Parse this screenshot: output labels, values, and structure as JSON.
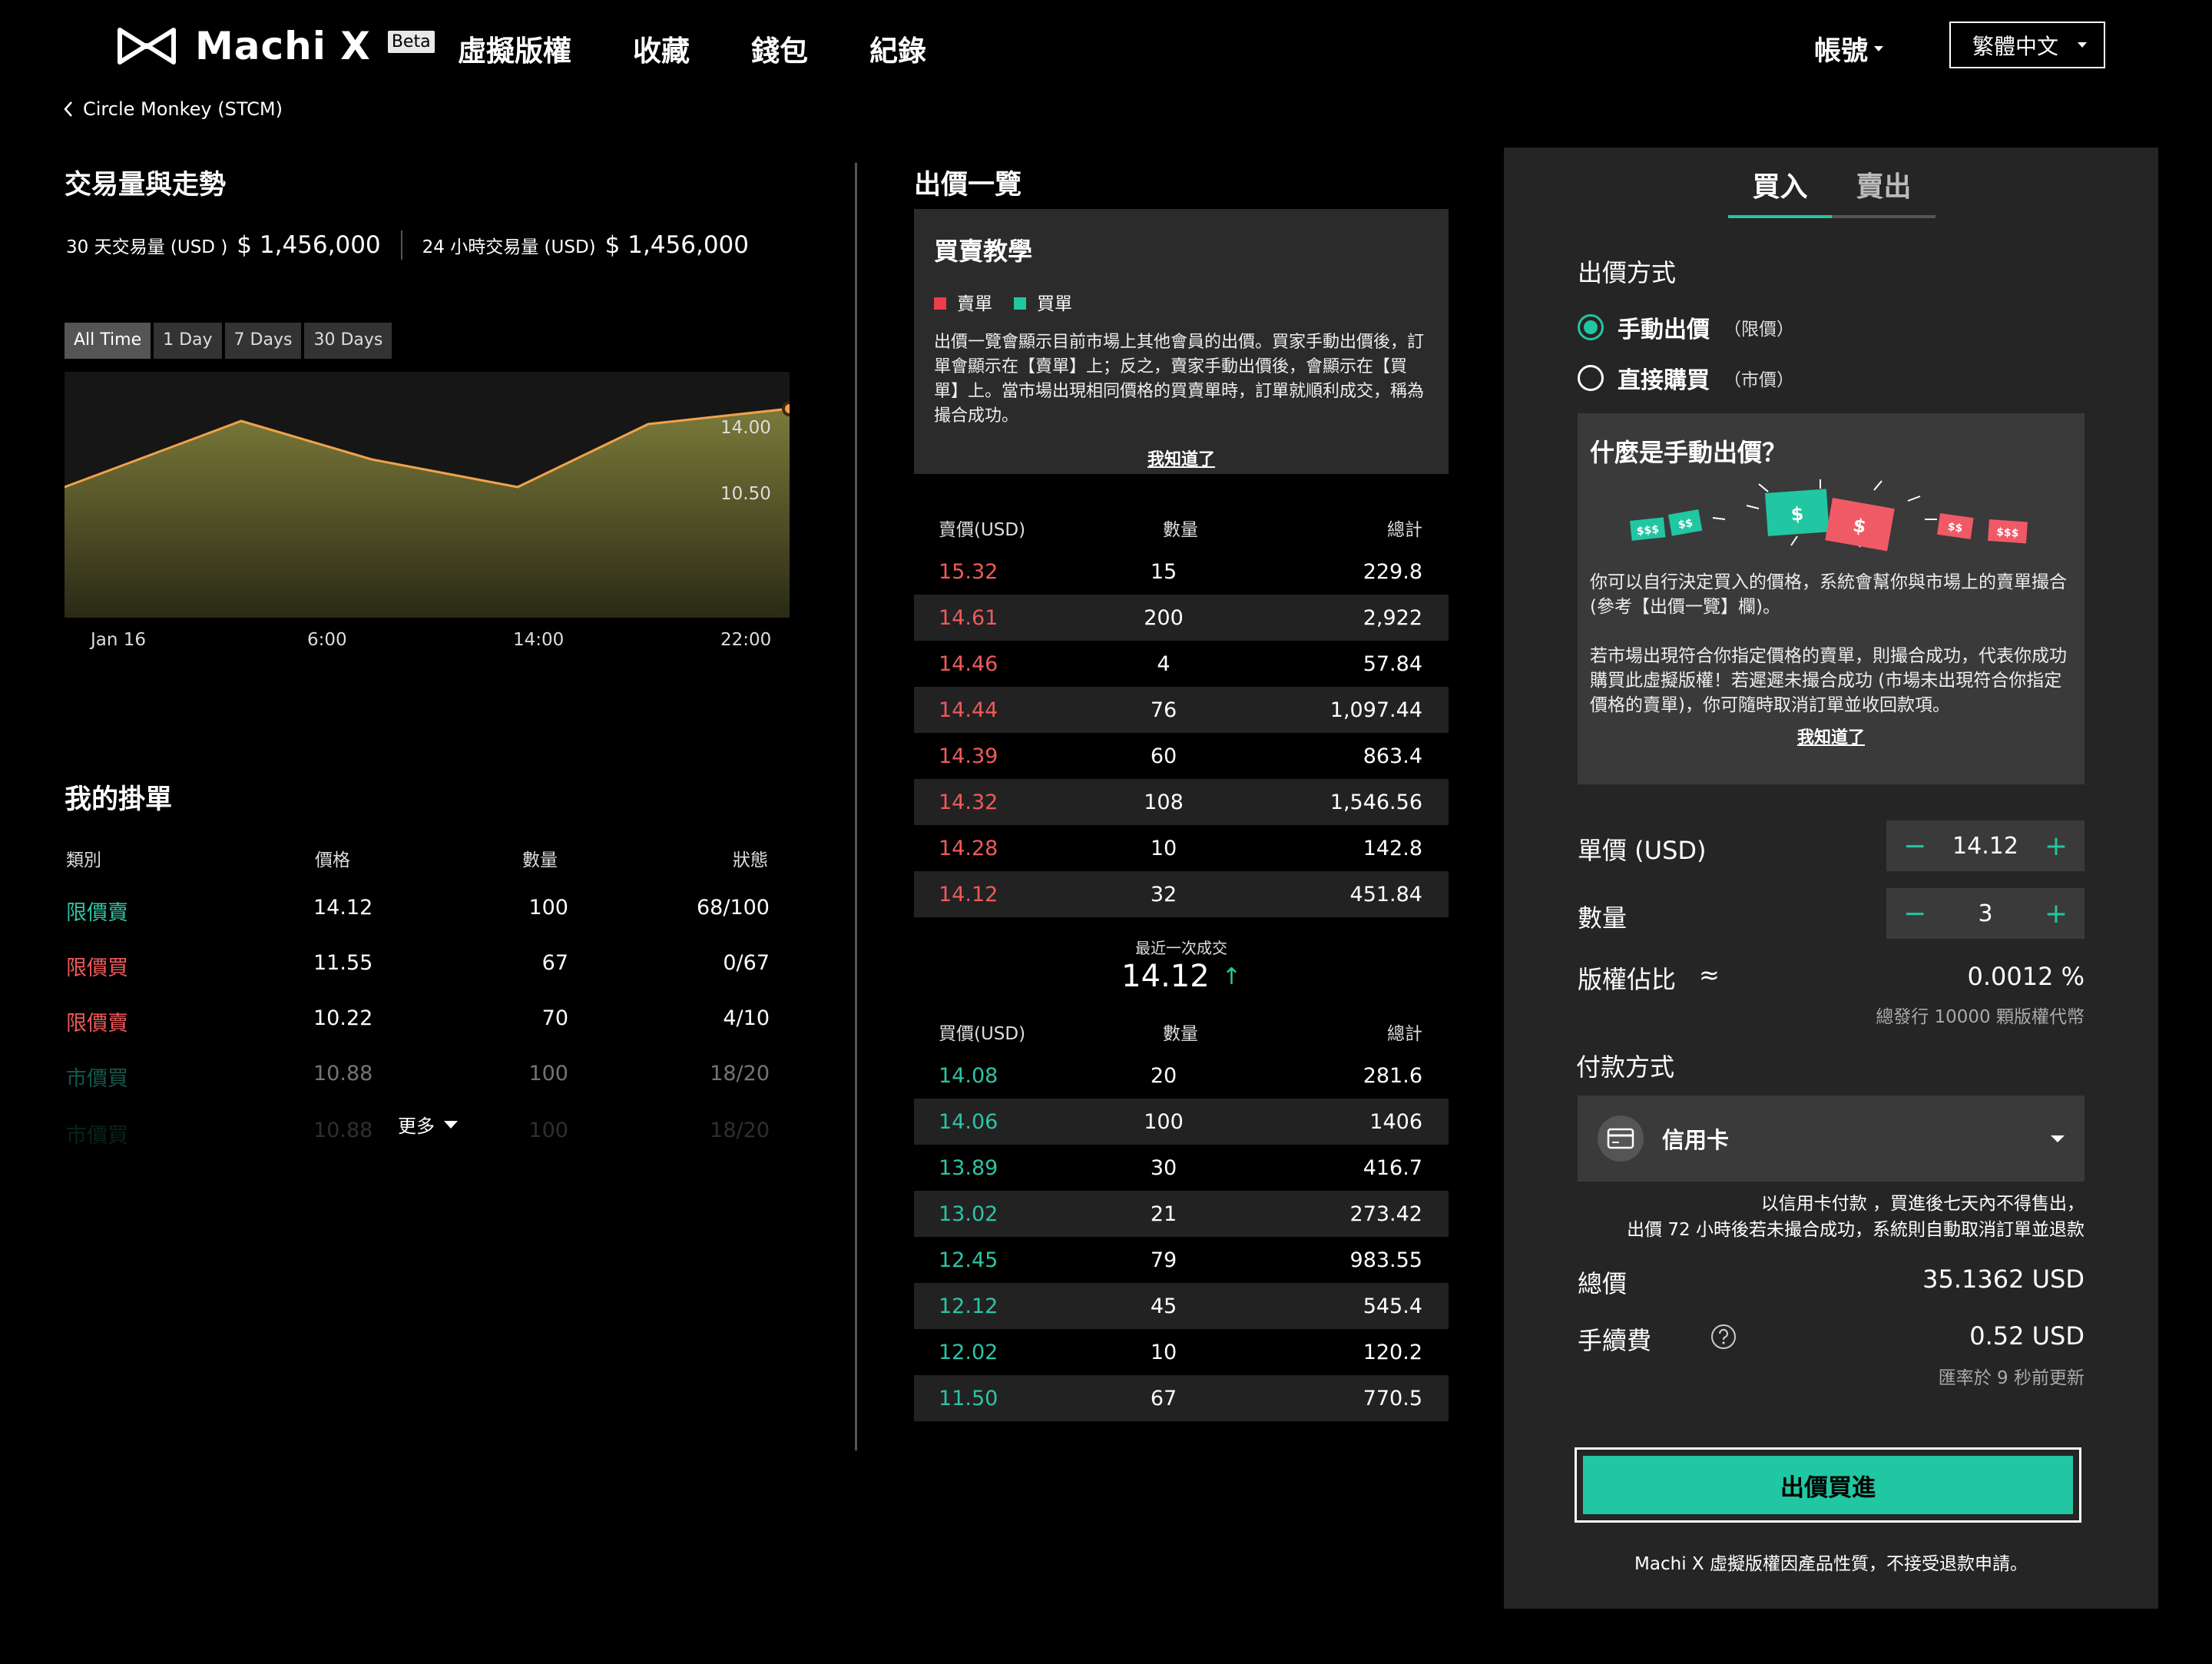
{
  "header": {
    "logo_text": "Machi X",
    "beta": "Beta",
    "nav": [
      "虛擬版權",
      "收藏",
      "錢包",
      "紀錄"
    ],
    "account": "帳號",
    "language": "繁體中文"
  },
  "breadcrumb": {
    "back_label": "Circle Monkey (STCM)"
  },
  "trend": {
    "title": "交易量與走勢",
    "vol30_label": "30 天交易量 (USD )",
    "vol30_value": "$ 1,456,000",
    "vol24_label": "24 小時交易量 (USD)",
    "vol24_value": "$ 1,456,000",
    "ranges": [
      "All Time",
      "1 Day",
      "7 Days",
      "30 Days"
    ],
    "active_range": "All Time"
  },
  "chart_data": {
    "type": "area",
    "x": [
      "Jan 16",
      "",
      "6:00",
      "",
      "14:00",
      "",
      "22:00",
      ""
    ],
    "x_tick_labels": [
      "Jan 16",
      "6:00",
      "14:00",
      "22:00"
    ],
    "y_tick_labels": [
      "14.00",
      "10.50"
    ],
    "series": [
      {
        "values": [
          9.5,
          13.8,
          11.3,
          9.5,
          13.6,
          14.6
        ]
      }
    ],
    "ylim": [
      1,
      17
    ],
    "colors": {
      "fill_top": "#7b7a3a",
      "line": "#f0a24a"
    }
  },
  "my_orders": {
    "title": "我的掛單",
    "columns": [
      "類別",
      "價格",
      "數量",
      "狀態"
    ],
    "rows": [
      {
        "type": "限價賣",
        "color": "green",
        "price": "14.12",
        "qty": "100",
        "status": "68/100"
      },
      {
        "type": "限價買",
        "color": "red",
        "price": "11.55",
        "qty": "67",
        "status": "0/67"
      },
      {
        "type": "限價賣",
        "color": "red",
        "price": "10.22",
        "qty": "70",
        "status": "4/10"
      },
      {
        "type": "市價買",
        "color": "green",
        "price": "10.88",
        "qty": "100",
        "status": "18/20"
      },
      {
        "type": "市價買",
        "color": "green",
        "price": "10.88",
        "qty": "100",
        "status": "18/20"
      }
    ],
    "more": "更多"
  },
  "orderbook": {
    "title": "出價一覽",
    "tutorial": {
      "title": "買賣教學",
      "sell_legend": "賣單",
      "buy_legend": "買單",
      "body": "出價一覽會顯示目前市場上其他會員的出價。買家手動出價後，訂單會顯示在【賣單】上；反之，賣家手動出價後，會顯示在【買單】上。當市場出現相同價格的買賣單時，訂單就順利成交，稱為撮合成功。",
      "ack": "我知道了"
    },
    "sell_head": [
      "賣價(USD)",
      "數量",
      "總計"
    ],
    "sells": [
      [
        "15.32",
        "15",
        "229.8"
      ],
      [
        "14.61",
        "200",
        "2,922"
      ],
      [
        "14.46",
        "4",
        "57.84"
      ],
      [
        "14.44",
        "76",
        "1,097.44"
      ],
      [
        "14.39",
        "60",
        "863.4"
      ],
      [
        "14.32",
        "108",
        "1,546.56"
      ],
      [
        "14.28",
        "10",
        "142.8"
      ],
      [
        "14.12",
        "32",
        "451.84"
      ]
    ],
    "last_label": "最近一次成交",
    "last_price": "14.12",
    "last_arrow": "↑",
    "buy_head": [
      "買價(USD)",
      "數量",
      "總計"
    ],
    "buys": [
      [
        "14.08",
        "20",
        "281.6"
      ],
      [
        "14.06",
        "100",
        "1406"
      ],
      [
        "13.89",
        "30",
        "416.7"
      ],
      [
        "13.02",
        "21",
        "273.42"
      ],
      [
        "12.45",
        "79",
        "983.55"
      ],
      [
        "12.12",
        "45",
        "545.4"
      ],
      [
        "12.02",
        "10",
        "120.2"
      ],
      [
        "11.50",
        "67",
        "770.5"
      ]
    ]
  },
  "trade": {
    "tabs": [
      "買入",
      "賣出"
    ],
    "active_tab": "買入",
    "method_title": "出價方式",
    "manual_label": "手動出價",
    "manual_sub": "（限價）",
    "direct_label": "直接購買",
    "direct_sub": "（市價）",
    "selected_method": "manual",
    "help": {
      "title": "什麼是手動出價？",
      "art_labels": [
        "$$$",
        "$$",
        "$",
        "$",
        "$$",
        "$$$"
      ],
      "p1": "你可以自行決定買入的價格，系統會幫你與市場上的賣單撮合 (參考【出價一覽】欄)。",
      "p2": "若市場出現符合你指定價格的賣單，則撮合成功，代表你成功購買此虛擬版權！若遲遲未撮合成功 (市場未出現符合你指定價格的賣單)，你可隨時取消訂單並收回款項。",
      "ack": "我知道了"
    },
    "price_label": "單價 (USD)",
    "price_value": "14.12",
    "qty_label": "數量",
    "qty_value": "3",
    "minus": "−",
    "plus": "+",
    "share_label": "版權佔比",
    "share_approx": "≈",
    "share_value": "0.0012 %",
    "share_note": "總發行 10000 顆版權代幣",
    "pay_title": "付款方式",
    "pay_method": "信用卡",
    "pay_note1": "以信用卡付款 ，買進後七天內不得售出，",
    "pay_note2": "出價 72 小時後若未撮合成功，系統則自動取消訂單並退款",
    "total_label": "總價",
    "total_value": "35.1362 USD",
    "fee_label": "手續費",
    "fee_value": "0.52 USD",
    "rate_note": "匯率於 9 秒前更新",
    "cta": "出價買進",
    "footer_note": "Machi X 虛擬版權因產品性質，不接受退款申請。"
  }
}
